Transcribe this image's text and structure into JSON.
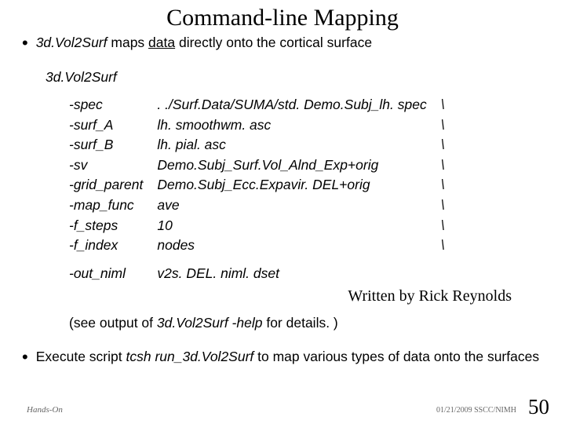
{
  "title": "Command-line Mapping",
  "bullet1": {
    "program": "3d.Vol2Surf",
    "rest1": " maps ",
    "underlined": "data",
    "rest2": " directly onto the cortical surface"
  },
  "cmd_name": "3d.Vol2Surf",
  "args": [
    {
      "flag": "-spec",
      "val": ". ./Surf.Data/SUMA/std. Demo.Subj_lh. spec",
      "cont": "\\"
    },
    {
      "flag": "-surf_A",
      "val": "lh. smoothwm. asc",
      "cont": "\\"
    },
    {
      "flag": "-surf_B",
      "val": "lh. pial. asc",
      "cont": "\\"
    },
    {
      "flag": "-sv",
      "val": "Demo.Subj_Surf.Vol_Alnd_Exp+orig",
      "cont": "\\"
    },
    {
      "flag": "-grid_parent",
      "val": "Demo.Subj_Ecc.Expavir. DEL+orig",
      "cont": "\\"
    },
    {
      "flag": "-map_func",
      "val": "ave",
      "cont": "\\"
    },
    {
      "flag": "-f_steps",
      "val": "10",
      "cont": "\\"
    },
    {
      "flag": "-f_index",
      "val": "nodes",
      "cont": "\\"
    }
  ],
  "out_arg": {
    "flag": "-out_niml",
    "val": "v2s. DEL. niml. dset"
  },
  "written_by": "Written by Rick Reynolds",
  "see_output": {
    "pre": "(see output of ",
    "prog": "3d.Vol2Surf -help",
    "post": " for details. )"
  },
  "bullet2": {
    "pre": "Execute script ",
    "script": "tcsh run_3d.Vol2Surf",
    "post": " to map various types of data onto the surfaces"
  },
  "footer": {
    "left": "Hands-On",
    "right": "01/21/2009 SSCC/NIMH",
    "page": "50"
  }
}
